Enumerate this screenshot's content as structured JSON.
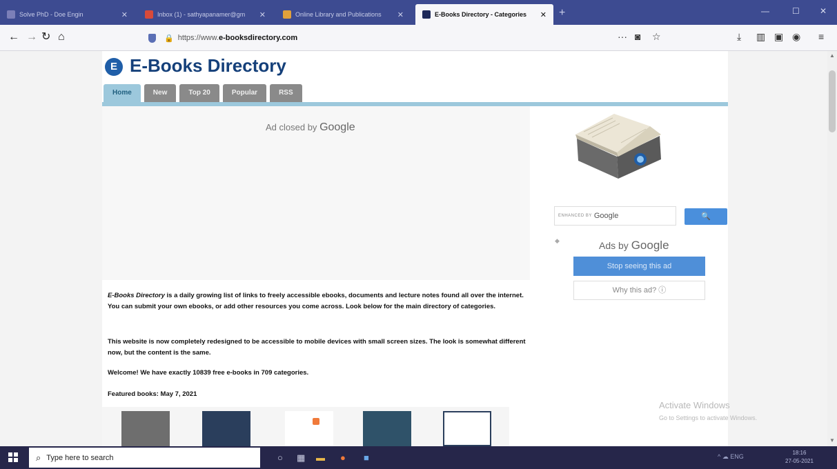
{
  "browser": {
    "tabs": [
      {
        "label": "Solve PhD - Doe Engin",
        "active": false,
        "favicon_color": "#7b7fb8"
      },
      {
        "label": "Inbox (1) - sathyapanamer@gm",
        "active": false,
        "favicon_color": "#d84a3a"
      },
      {
        "label": "Online Library and Publications",
        "active": false,
        "favicon_color": "#e2a13b"
      },
      {
        "label": "E-Books Directory - Categories",
        "active": true,
        "favicon_color": "#1f2a5a"
      }
    ],
    "new_tab_glyph": "+",
    "close_glyph": "✕",
    "window_buttons": [
      "—",
      "☐",
      "✕"
    ],
    "url_prefix": "https://www.",
    "url_domain": "e-booksdirectory.com",
    "page_actions_glyph": "···"
  },
  "site": {
    "logo_letter": "E",
    "title": "E-Books Directory",
    "menu": [
      {
        "label": "Home",
        "active": true
      },
      {
        "label": "New",
        "active": false
      },
      {
        "label": "Top 20",
        "active": false
      },
      {
        "label": "Popular",
        "active": false
      },
      {
        "label": "RSS",
        "active": false
      }
    ],
    "ad_closed_prefix": "Ad closed by",
    "ad_closed_brand": "Google",
    "search_label_prefix": "ENHANCED BY",
    "search_label_brand": "Google",
    "search_button_glyph": "🔍",
    "ads_by_prefix": "Ads by",
    "ads_by_brand": "Google",
    "stop_button": "Stop seeing this ad",
    "why_button": "Why this ad? ⓘ",
    "intro_title": "E-Books Directory",
    "intro_rest": " is a daily growing list of links to freely accessible ebooks, documents and lecture notes found all over the internet. You can submit your own ebooks, or add other resources you come across. Look below for the main directory of categories.",
    "redesign_note": "This website is now completely redesigned to be accessible to mobile devices with small screen sizes. The look is somewhat different now, but the content is the same.",
    "welcome_prefix": "Welcome! We have exactly ",
    "book_count": "10839",
    "welcome_mid": " free e-books in ",
    "category_count": "709",
    "welcome_suffix": " categories.",
    "featured_label": "Featured books: May 7, 2021",
    "featured_thumb_colors": [
      "#6e6e6e",
      "#2a3e5c",
      "#ffffff",
      "#2f5269",
      "#ffffff"
    ]
  },
  "watermark": {
    "line1": "Activate Windows",
    "line2": "Go to Settings to activate Windows."
  },
  "taskbar": {
    "search_placeholder": "Type here to search",
    "tray_text": "^  ☁  ENG",
    "time": "18:16",
    "date": "27-05-2021"
  }
}
